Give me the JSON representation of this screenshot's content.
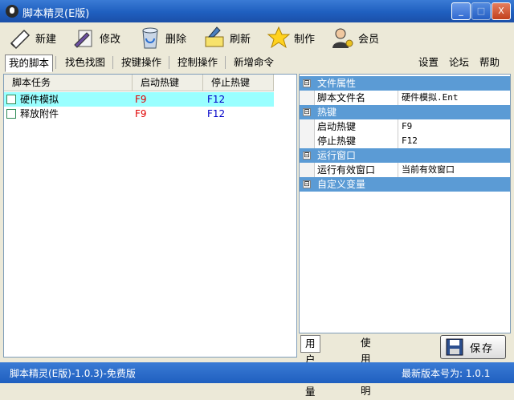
{
  "window": {
    "title": "脚本精灵(E版)",
    "minimize": "_",
    "maximize": "□",
    "close": "X"
  },
  "toolbar": [
    {
      "label": "新建",
      "icon": "new-icon"
    },
    {
      "label": "修改",
      "icon": "edit-icon"
    },
    {
      "label": "删除",
      "icon": "delete-icon"
    },
    {
      "label": "刷新",
      "icon": "refresh-icon"
    },
    {
      "label": "制作",
      "icon": "star-icon"
    },
    {
      "label": "会员",
      "icon": "member-icon"
    }
  ],
  "tabs": [
    "我的脚本",
    "找色找图",
    "按键操作",
    "控制操作",
    "新增命令"
  ],
  "links": [
    "设置",
    "论坛",
    "帮助"
  ],
  "task_table": {
    "columns": [
      "脚本任务",
      "启动热键",
      "停止热键"
    ],
    "rows": [
      {
        "name": "硬件模拟",
        "start": "F9",
        "stop": "F12",
        "selected": true
      },
      {
        "name": "释放附件",
        "start": "F9",
        "stop": "F12",
        "selected": false
      }
    ]
  },
  "property_grid": {
    "cat1": {
      "title": "文件属性",
      "toggle": "⊟"
    },
    "p1": {
      "name": "脚本文件名",
      "value": "硬件模拟.Ent"
    },
    "cat2": {
      "title": "热键",
      "toggle": "⊟"
    },
    "p2": {
      "name": "启动热键",
      "value": "F9"
    },
    "p3": {
      "name": "停止热键",
      "value": "F12"
    },
    "cat3": {
      "title": "运行窗口",
      "toggle": "⊟"
    },
    "p4": {
      "name": "运行有效窗口",
      "value": "当前有效窗口"
    },
    "cat4": {
      "title": "自定义变量",
      "toggle": "⊟"
    }
  },
  "bottom_tabs": [
    "用户变量",
    "使用说明"
  ],
  "save_button": "保存",
  "status": {
    "left": "脚本精灵(E版)-1.0.3)-免费版",
    "right": "最新版本号为: 1.0.1"
  },
  "colors": {
    "title_bar": "#1f5fbf",
    "selected_row": "#99ffff",
    "category": "#5b9bd5",
    "hotkey_start": "#e00000",
    "hotkey_stop": "#0000c8"
  }
}
